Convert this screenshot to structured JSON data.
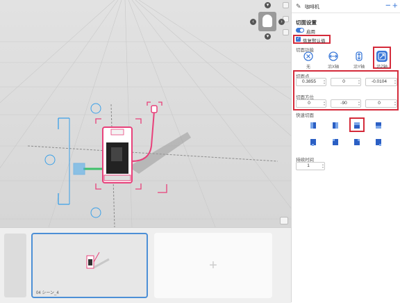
{
  "panel": {
    "title": "咖啡机",
    "section_title": "切面设置",
    "enable_label": "启用",
    "restore_label": "恢复默认值",
    "clip_function_label": "切面功能",
    "modes": [
      {
        "label": "无",
        "icon": "circle-x-icon"
      },
      {
        "label": "沿X轴",
        "icon": "x-axis-icon"
      },
      {
        "label": "沿Y轴",
        "icon": "y-axis-icon"
      },
      {
        "label": "沿Z轴",
        "icon": "z-axis-icon"
      }
    ],
    "selected_mode": "沿Z轴",
    "clip_point_label": "切面点",
    "clip_point": [
      "0.3855",
      "0",
      "-0.0104"
    ],
    "clip_direction_label": "切面方位",
    "clip_direction": [
      "0",
      "-90",
      "0"
    ],
    "quick_clip_label": "快速切面",
    "duration_label": "持续时间",
    "duration_value": "1"
  },
  "scene": {
    "thumbnail_label": "04  シーン_4"
  },
  "colors": {
    "accent": "#3a78d8",
    "highlight_red": "#d42a3a",
    "selection_pink": "#e8407a",
    "gizmo_blue": "#3aa0e8"
  }
}
